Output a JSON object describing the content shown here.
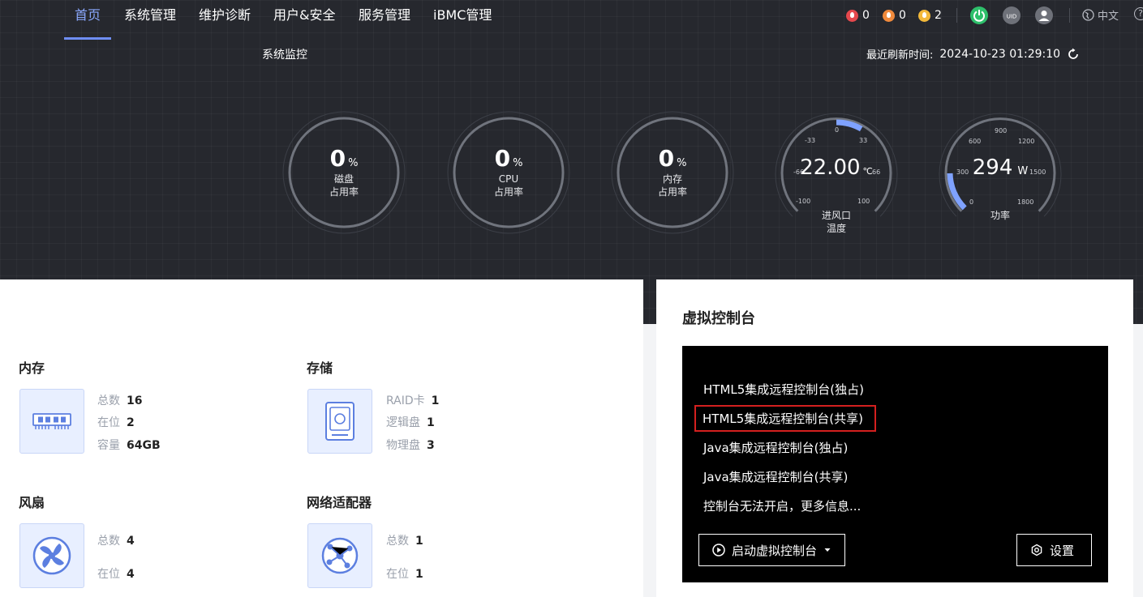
{
  "nav": {
    "items": [
      "首页",
      "系统管理",
      "维护诊断",
      "用户&安全",
      "服务管理",
      "iBMC管理"
    ],
    "active_index": 0
  },
  "alarms": {
    "critical": "0",
    "major": "0",
    "minor": "2",
    "colors": {
      "critical": "#e5484d",
      "major": "#f08a3c",
      "minor": "#f3b93a"
    }
  },
  "header": {
    "language": "中文",
    "help": "?"
  },
  "monitor": {
    "title": "系统监控",
    "refresh_label": "最近刷新时间:",
    "refresh_time": "2024-10-23 01:29:10",
    "disk": {
      "value": "0",
      "unit": "%",
      "label1": "磁盘",
      "label2": "占用率"
    },
    "cpu": {
      "value": "0",
      "unit": "%",
      "label1": "CPU",
      "label2": "占用率"
    },
    "memory": {
      "value": "0",
      "unit": "%",
      "label1": "内存",
      "label2": "占用率"
    },
    "inlet_temp": {
      "value": "22.00",
      "unit": "℃",
      "label1": "进风口",
      "label2": "温度",
      "ticks": [
        "-100",
        "-66",
        "-33",
        "0",
        "33",
        "66",
        "100"
      ],
      "min": -100,
      "max": 100
    },
    "power": {
      "value": "294",
      "unit": "W",
      "label1": "功率",
      "ticks": [
        "0",
        "300",
        "600",
        "900",
        "1200",
        "1500",
        "1800"
      ],
      "min": 0,
      "max": 1800
    },
    "accent": "#7fa2ff"
  },
  "overview": {
    "memory": {
      "title": "内存",
      "rows": [
        [
          "总数",
          "16"
        ],
        [
          "在位",
          "2"
        ],
        [
          "容量",
          "64GB"
        ]
      ]
    },
    "storage": {
      "title": "存储",
      "rows": [
        [
          "RAID卡",
          "1"
        ],
        [
          "逻辑盘",
          "1"
        ],
        [
          "物理盘",
          "3"
        ]
      ]
    },
    "fan": {
      "title": "风扇",
      "rows": [
        [
          "总数",
          "4"
        ],
        [
          "在位",
          "4"
        ]
      ]
    },
    "network": {
      "title": "网络适配器",
      "rows": [
        [
          "总数",
          "1"
        ],
        [
          "在位",
          "1"
        ]
      ]
    }
  },
  "console": {
    "title": "虚拟控制台",
    "items": [
      "HTML5集成远程控制台(独占)",
      "HTML5集成远程控制台(共享)",
      "Java集成远程控制台(独占)",
      "Java集成远程控制台(共享)",
      "控制台无法开启，更多信息..."
    ],
    "highlighted_index": 1,
    "launch_button": "启动虚拟控制台",
    "settings_button": "设置"
  }
}
